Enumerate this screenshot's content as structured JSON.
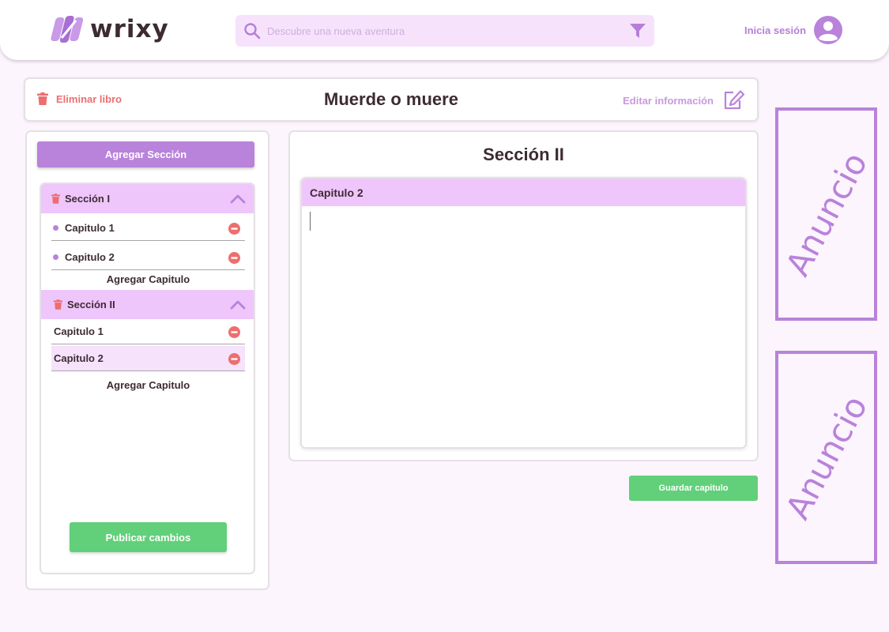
{
  "header": {
    "brand": "wrixy",
    "search_placeholder": "Descubre una nueva aventura",
    "login_label": "Inicia sesión"
  },
  "book": {
    "delete_label": "Eliminar libro",
    "title": "Muerde o muere",
    "edit_label": "Editar información"
  },
  "sidebar": {
    "add_section_label": "Agregar Sección",
    "sections": [
      {
        "label": "Sección I",
        "chapters": [
          {
            "label": "Capitulo 1"
          },
          {
            "label": "Capitulo 2"
          }
        ],
        "add_chapter_label": "Agregar Capitulo"
      },
      {
        "label": "Sección II",
        "chapters": [
          {
            "label": "Capitulo 1"
          },
          {
            "label": "Capitulo 2"
          }
        ],
        "add_chapter_label": "Agregar Capitulo"
      }
    ],
    "publish_label": "Publicar cambios"
  },
  "editor": {
    "section_title": "Sección II",
    "chapter_title": "Capitulo 2",
    "content": "",
    "save_label": "Guardar capitulo"
  },
  "ads": [
    {
      "label": "Anuncio"
    },
    {
      "label": "Anuncio"
    }
  ],
  "colors": {
    "accent": "#b982db",
    "accent_light": "#efc6fb",
    "danger": "#ee6e6e",
    "success": "#62d07a",
    "text": "#3d2b33"
  },
  "icons": [
    "logo-icon",
    "search-icon",
    "filter-icon",
    "user-avatar-icon",
    "trash-icon",
    "edit-icon",
    "chevron-up-icon",
    "remove-icon"
  ]
}
